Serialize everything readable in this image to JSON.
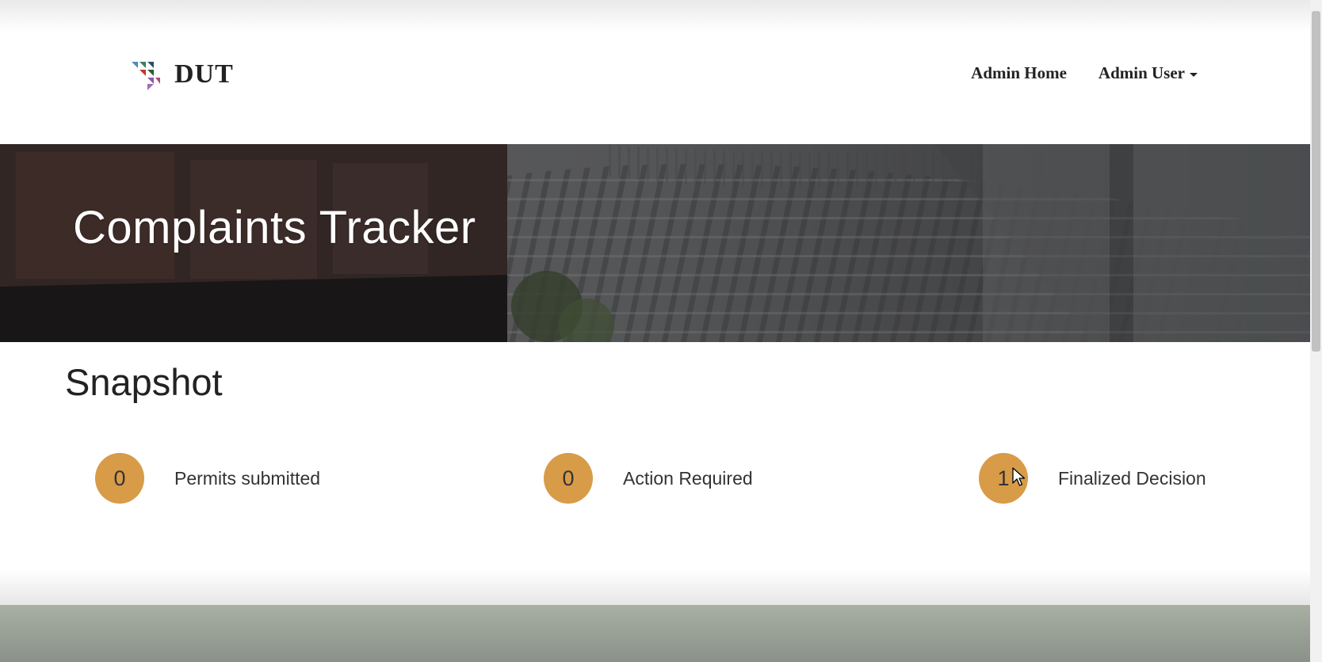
{
  "brand": {
    "name": "DUT",
    "icon": "triangle-logo-icon"
  },
  "nav": {
    "admin_home": "Admin Home",
    "admin_user": "Admin User"
  },
  "hero": {
    "title": "Complaints Tracker"
  },
  "snapshot": {
    "title": "Snapshot",
    "stats": [
      {
        "count": "0",
        "label": "Permits submitted"
      },
      {
        "count": "0",
        "label": "Action Required"
      },
      {
        "count": "1",
        "label": "Finalized Decision"
      }
    ]
  },
  "colors": {
    "stat_circle": "#d89b48",
    "text": "#222222",
    "footer": "#a8b0a4"
  }
}
